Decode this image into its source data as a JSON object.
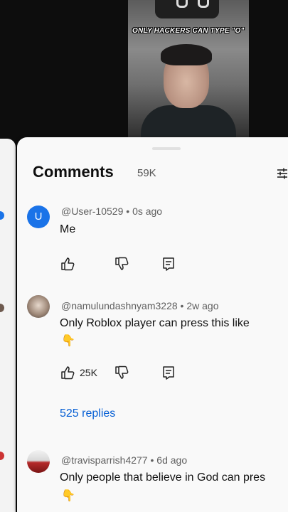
{
  "video": {
    "caption": "ONLY HACKERS CAN TYPE \"O\""
  },
  "comments_panel": {
    "title": "Comments",
    "count": "59K"
  },
  "comments": [
    {
      "author": "@User-10529",
      "time": "0s ago",
      "avatar_letter": "U",
      "avatar_color": "#1a73e8",
      "text": "Me"
    },
    {
      "author": "@namulundashnyam3228",
      "time": "2w ago",
      "text": "Only Roblox player can press this like",
      "likes": "25K",
      "replies": "525 replies"
    },
    {
      "author": "@travisparrish4277",
      "time": "6d ago",
      "text": "Only people that believe in God can pres"
    }
  ],
  "separator": " • ",
  "icons": [
    "thumb-up-icon",
    "thumb-down-icon",
    "reply-icon",
    "filter-icon",
    "pointing-down-hand-icon"
  ]
}
